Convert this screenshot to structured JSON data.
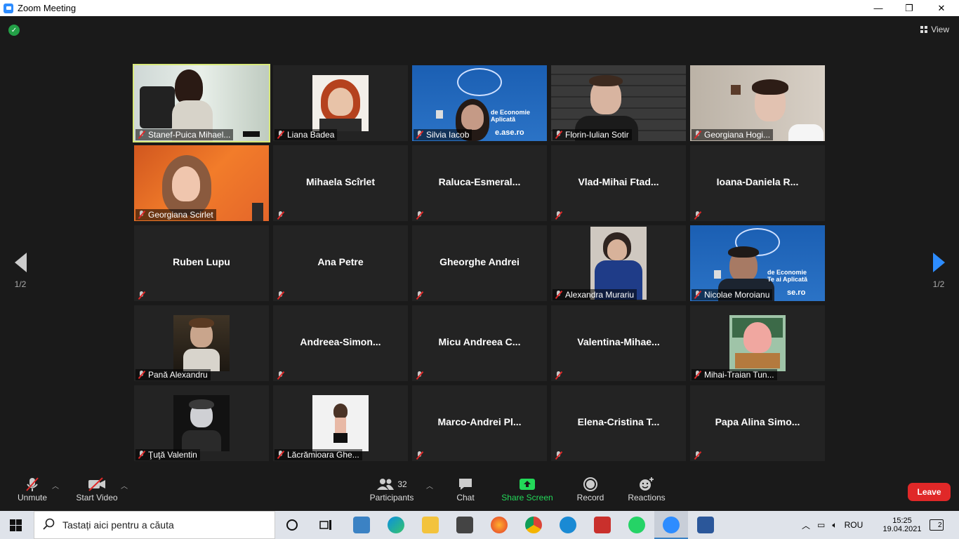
{
  "window": {
    "title": "Zoom Meeting",
    "minimize": "—",
    "maximize": "❐",
    "close": "✕"
  },
  "top_right": {
    "view_label": "View"
  },
  "pager": {
    "left_page": "1/2",
    "right_page": "1/2"
  },
  "tiles": [
    {
      "name": "Stanef-Puica Mihael...",
      "type": "video",
      "active": true
    },
    {
      "name": "Liana Badea",
      "type": "photo"
    },
    {
      "name": "Silvia Iacob",
      "type": "video"
    },
    {
      "name": "Florin-Iulian Sotir",
      "type": "video"
    },
    {
      "name": "Georgiana Hogi...",
      "type": "video"
    },
    {
      "name": "Georgiana Scirlet",
      "type": "video"
    },
    {
      "name": "Mihaela Scîrlet",
      "type": "name"
    },
    {
      "name": "Raluca-Esmeral...",
      "type": "name"
    },
    {
      "name": "Vlad-Mihai  Ftad...",
      "type": "name"
    },
    {
      "name": "Ioana-Daniela  R...",
      "type": "name"
    },
    {
      "name": "Ruben Lupu",
      "type": "name"
    },
    {
      "name": "Ana Petre",
      "type": "name"
    },
    {
      "name": "Gheorghe Andrei",
      "type": "name"
    },
    {
      "name": "Alexandra Murariu",
      "type": "photo"
    },
    {
      "name": "Nicolae Moroianu",
      "type": "video"
    },
    {
      "name": "Pană Alexandru",
      "type": "photo"
    },
    {
      "name": "Andreea-Simon...",
      "type": "name"
    },
    {
      "name": "Micu  Andreea  C...",
      "type": "name"
    },
    {
      "name": "Valentina-Mihae...",
      "type": "name"
    },
    {
      "name": "Mihai-Traian Tun...",
      "type": "photo"
    },
    {
      "name": "Ţuţă Valentin",
      "type": "photo"
    },
    {
      "name": "Lăcrămioara Ghe...",
      "type": "photo"
    },
    {
      "name": "Marco-Andrei  Pl...",
      "type": "name"
    },
    {
      "name": "Elena-Cristina  T...",
      "type": "name"
    },
    {
      "name": "Papa  Alina  Simo...",
      "type": "name"
    }
  ],
  "banner": {
    "line1": "de Economie",
    "line2": "Aplicată",
    "site": "e.ase.ro",
    "line1b": "de Economie",
    "line2b": "Te    ai Aplicată",
    "siteb": "se.ro"
  },
  "toolbar": {
    "unmute": "Unmute",
    "start_video": "Start Video",
    "participants": "Participants",
    "participants_count": "32",
    "chat": "Chat",
    "share_screen": "Share Screen",
    "record": "Record",
    "reactions": "Reactions",
    "leave": "Leave",
    "share_color": "#23d959",
    "leave_color": "#e02828"
  },
  "taskbar": {
    "search_placeholder": "Tastați aici pentru a căuta",
    "language": "ROU",
    "time": "15:25",
    "date": "19.04.2021",
    "notifications": "2"
  }
}
